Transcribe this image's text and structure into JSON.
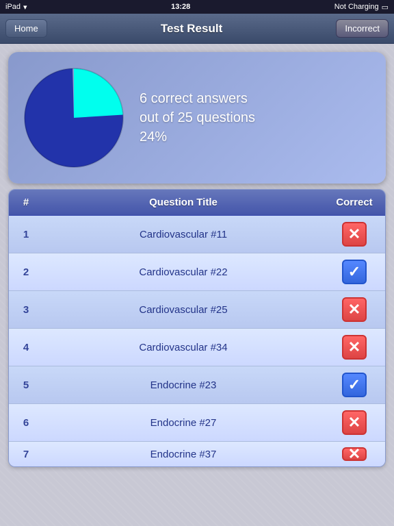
{
  "statusBar": {
    "left": "iPad",
    "wifi": "wifi-icon",
    "time": "13:28",
    "charging": "Not Charging",
    "battery": "battery-icon"
  },
  "navBar": {
    "homeLabel": "Home",
    "title": "Test Result",
    "incorrectLabel": "Incorrect"
  },
  "summary": {
    "correctAnswers": 6,
    "totalQuestions": 25,
    "percentage": "24%",
    "descLine1": "6 correct answers",
    "descLine2": "out of 25 questions",
    "descLine3": "24%",
    "correctFraction": 0.24,
    "incorrectFraction": 0.76,
    "correctColor": "#00ffee",
    "incorrectColor": "#2233aa"
  },
  "table": {
    "columns": [
      "#",
      "Question Title",
      "Correct"
    ],
    "rows": [
      {
        "num": "1",
        "title": "Cardiovascular #11",
        "correct": false
      },
      {
        "num": "2",
        "title": "Cardiovascular #22",
        "correct": true
      },
      {
        "num": "3",
        "title": "Cardiovascular #25",
        "correct": false
      },
      {
        "num": "4",
        "title": "Cardiovascular #34",
        "correct": false
      },
      {
        "num": "5",
        "title": "Endocrine #23",
        "correct": true
      },
      {
        "num": "6",
        "title": "Endocrine #27",
        "correct": false
      },
      {
        "num": "7",
        "title": "Endocrine #37",
        "correct": false
      }
    ]
  },
  "icons": {
    "checkmark": "✓",
    "cross": "✕"
  }
}
